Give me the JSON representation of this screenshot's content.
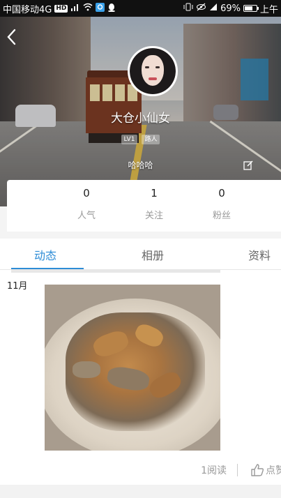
{
  "status_bar": {
    "carrier": "中国移动4G",
    "hd": "HD",
    "signal": "⁴ᴳ",
    "battery_text": "69%",
    "battery_level": 0.69,
    "time": "上午"
  },
  "profile": {
    "username": "大仓小仙女",
    "level_badge": "LV1",
    "role_badge": "路人",
    "bio": "哈哈哈"
  },
  "stats": [
    {
      "value": "0",
      "label": "人气"
    },
    {
      "value": "1",
      "label": "关注"
    },
    {
      "value": "0",
      "label": "粉丝"
    }
  ],
  "tabs": [
    {
      "label": "动态",
      "active": true
    },
    {
      "label": "相册",
      "active": false
    },
    {
      "label": "资料",
      "active": false
    }
  ],
  "feed": {
    "month": "11月",
    "read_count": "1阅读",
    "like_label": "点赞"
  },
  "colors": {
    "accent": "#2d8cd6",
    "muted": "#999999"
  },
  "icons": {
    "back": "chevron-left-icon",
    "edit": "edit-icon",
    "like": "thumbs-up-icon"
  }
}
